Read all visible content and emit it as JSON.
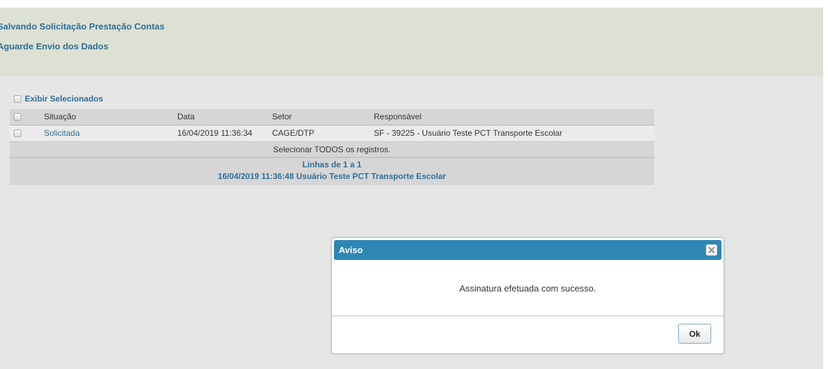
{
  "header": {
    "line1": "Salvando Solicitação Prestação Contas",
    "line2": "Aguarde Envio dos Dados"
  },
  "filter": {
    "exibir_selecionados_label": "Exibir Selecionados"
  },
  "table": {
    "columns": {
      "situacao": "Situação",
      "data": "Data",
      "setor": "Setor",
      "responsavel": "Responsável"
    },
    "rows": [
      {
        "situacao": "Solicitada",
        "data": "16/04/2019 11:36:34",
        "setor": "CAGE/DTP",
        "responsavel": "SF - 39225 - Usuário Teste PCT Transporte Escolar"
      }
    ],
    "select_all_label": "Selecionar TODOS os registros.",
    "footer": {
      "lines_text": "Linhas de 1 a 1",
      "timestamp_user": "16/04/2019 11:36:48  Usuário Teste PCT Transporte Escolar"
    }
  },
  "dialog": {
    "title": "Aviso",
    "message": "Assinatura efetuada com sucesso.",
    "ok_label": "Ok",
    "close_icon": "close-icon"
  },
  "colors": {
    "accent": "#2e6f9a",
    "dialog_title_bar": "#2f86b5",
    "header_bg": "#dde1d4",
    "page_bg": "#e6e6e6"
  }
}
